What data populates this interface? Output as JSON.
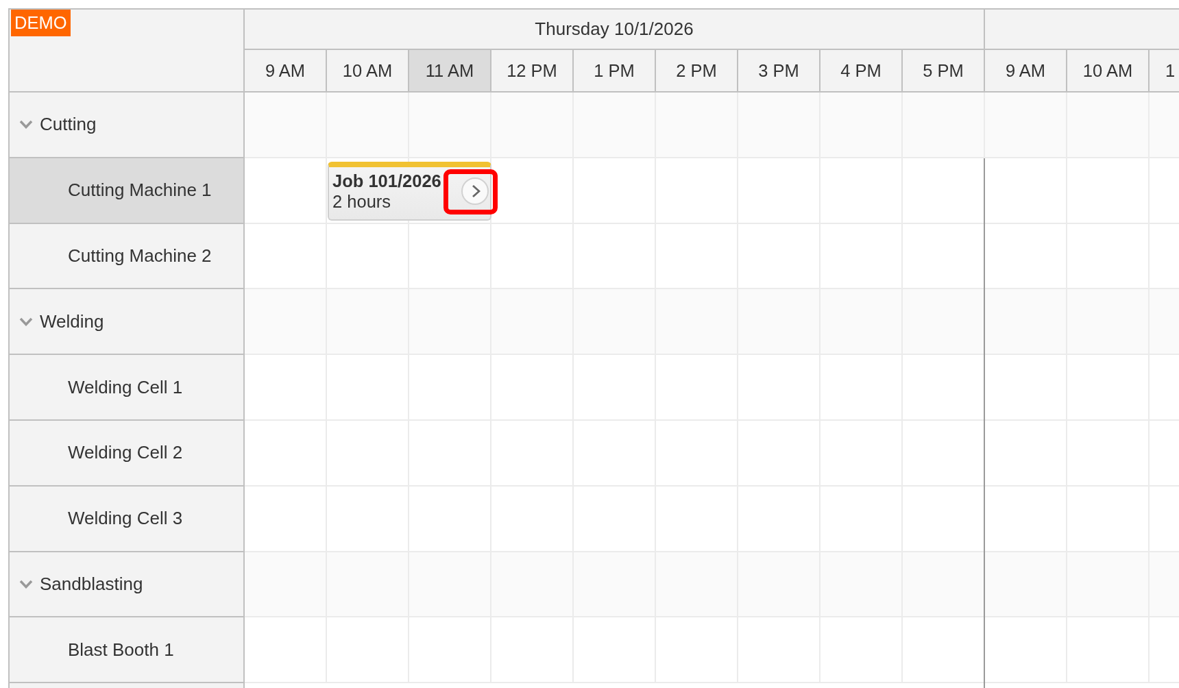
{
  "badge": "DEMO",
  "timeline": {
    "days": [
      {
        "label": "Thursday 10/1/2026",
        "hours": [
          {
            "label": "9 AM",
            "selected": false
          },
          {
            "label": "10 AM",
            "selected": false
          },
          {
            "label": "11 AM",
            "selected": true
          },
          {
            "label": "12 PM",
            "selected": false
          },
          {
            "label": "1 PM",
            "selected": false
          },
          {
            "label": "2 PM",
            "selected": false
          },
          {
            "label": "3 PM",
            "selected": false
          },
          {
            "label": "4 PM",
            "selected": false
          },
          {
            "label": "5 PM",
            "selected": false
          }
        ]
      },
      {
        "hours": [
          {
            "label": "9 AM",
            "selected": false
          },
          {
            "label": "10 AM",
            "selected": false
          },
          {
            "label": "1",
            "selected": false
          }
        ]
      }
    ]
  },
  "resources": [
    {
      "name": "Cutting",
      "expanded": true,
      "selected": false,
      "children": [
        {
          "name": "Cutting Machine 1",
          "selected": true,
          "events": [
            {
              "title": "Job 101/2026",
              "text": "2 hours",
              "action": {
                "highlighted": true
              }
            }
          ]
        },
        {
          "name": "Cutting Machine 2",
          "selected": false
        }
      ]
    },
    {
      "name": "Welding",
      "expanded": true,
      "selected": false,
      "children": [
        {
          "name": "Welding Cell 1",
          "selected": false
        },
        {
          "name": "Welding Cell 2",
          "selected": false
        },
        {
          "name": "Welding Cell 3",
          "selected": false
        }
      ]
    },
    {
      "name": "Sandblasting",
      "expanded": true,
      "selected": false,
      "children": [
        {
          "name": "Blast Booth 1",
          "selected": false
        }
      ]
    }
  ]
}
